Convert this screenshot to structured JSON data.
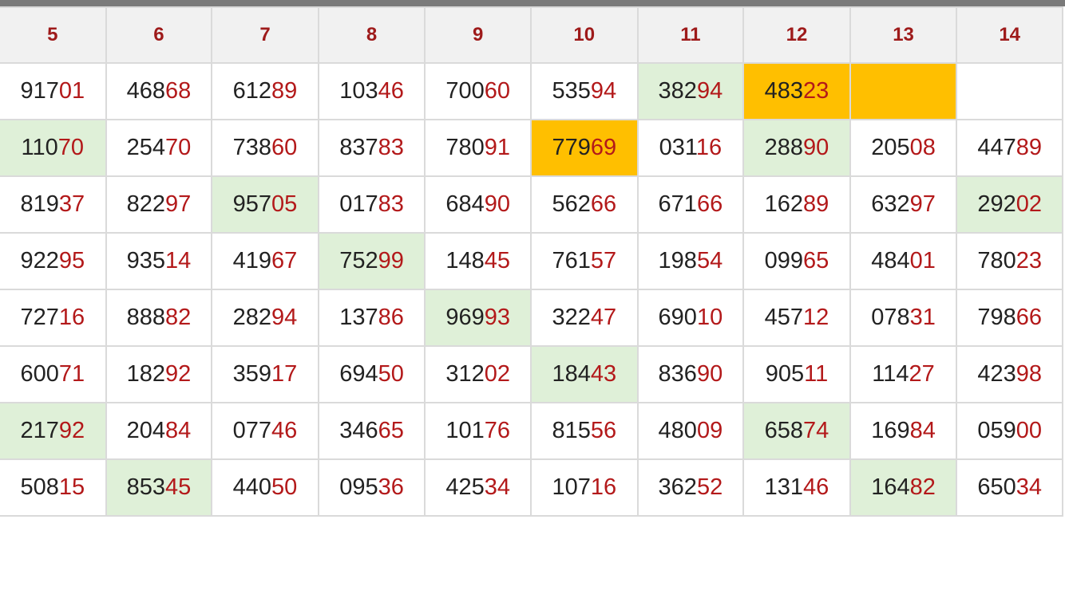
{
  "colors": {
    "header_text": "#9e1a1a",
    "tail_digits": "#b3191a",
    "green_highlight": "#dff0d8",
    "orange_highlight": "#ffbf00"
  },
  "columns": [
    "5",
    "6",
    "7",
    "8",
    "9",
    "10",
    "11",
    "12",
    "13",
    "14"
  ],
  "rows": [
    [
      {
        "head": "917",
        "tail": "01"
      },
      {
        "head": "468",
        "tail": "68"
      },
      {
        "head": "612",
        "tail": "89"
      },
      {
        "head": "103",
        "tail": "46"
      },
      {
        "head": "700",
        "tail": "60"
      },
      {
        "head": "535",
        "tail": "94"
      },
      {
        "head": "382",
        "tail": "94",
        "hl": "green"
      },
      {
        "head": "483",
        "tail": "23",
        "hl": "orange"
      },
      {
        "head": "",
        "tail": "",
        "hl": "orange"
      },
      {
        "head": "",
        "tail": ""
      }
    ],
    [
      {
        "head": "110",
        "tail": "70",
        "hl": "green"
      },
      {
        "head": "254",
        "tail": "70"
      },
      {
        "head": "738",
        "tail": "60"
      },
      {
        "head": "837",
        "tail": "83"
      },
      {
        "head": "780",
        "tail": "91"
      },
      {
        "head": "779",
        "tail": "69",
        "hl": "orange"
      },
      {
        "head": "031",
        "tail": "16"
      },
      {
        "head": "288",
        "tail": "90",
        "hl": "green"
      },
      {
        "head": "205",
        "tail": "08"
      },
      {
        "head": "447",
        "tail": "89"
      }
    ],
    [
      {
        "head": "819",
        "tail": "37"
      },
      {
        "head": "822",
        "tail": "97"
      },
      {
        "head": "957",
        "tail": "05",
        "hl": "green"
      },
      {
        "head": "017",
        "tail": "83"
      },
      {
        "head": "684",
        "tail": "90"
      },
      {
        "head": "562",
        "tail": "66"
      },
      {
        "head": "671",
        "tail": "66"
      },
      {
        "head": "162",
        "tail": "89"
      },
      {
        "head": "632",
        "tail": "97"
      },
      {
        "head": "292",
        "tail": "02",
        "hl": "green"
      }
    ],
    [
      {
        "head": "922",
        "tail": "95"
      },
      {
        "head": "935",
        "tail": "14"
      },
      {
        "head": "419",
        "tail": "67"
      },
      {
        "head": "752",
        "tail": "99",
        "hl": "green"
      },
      {
        "head": "148",
        "tail": "45"
      },
      {
        "head": "761",
        "tail": "57"
      },
      {
        "head": "198",
        "tail": "54"
      },
      {
        "head": "099",
        "tail": "65"
      },
      {
        "head": "484",
        "tail": "01"
      },
      {
        "head": "780",
        "tail": "23"
      }
    ],
    [
      {
        "head": "727",
        "tail": "16"
      },
      {
        "head": "888",
        "tail": "82"
      },
      {
        "head": "282",
        "tail": "94"
      },
      {
        "head": "137",
        "tail": "86"
      },
      {
        "head": "969",
        "tail": "93",
        "hl": "green"
      },
      {
        "head": "322",
        "tail": "47"
      },
      {
        "head": "690",
        "tail": "10"
      },
      {
        "head": "457",
        "tail": "12"
      },
      {
        "head": "078",
        "tail": "31"
      },
      {
        "head": "798",
        "tail": "66"
      }
    ],
    [
      {
        "head": "600",
        "tail": "71"
      },
      {
        "head": "182",
        "tail": "92"
      },
      {
        "head": "359",
        "tail": "17"
      },
      {
        "head": "694",
        "tail": "50"
      },
      {
        "head": "312",
        "tail": "02"
      },
      {
        "head": "184",
        "tail": "43",
        "hl": "green"
      },
      {
        "head": "836",
        "tail": "90"
      },
      {
        "head": "905",
        "tail": "11"
      },
      {
        "head": "114",
        "tail": "27"
      },
      {
        "head": "423",
        "tail": "98"
      }
    ],
    [
      {
        "head": "217",
        "tail": "92",
        "hl": "green"
      },
      {
        "head": "204",
        "tail": "84"
      },
      {
        "head": "077",
        "tail": "46"
      },
      {
        "head": "346",
        "tail": "65"
      },
      {
        "head": "101",
        "tail": "76"
      },
      {
        "head": "815",
        "tail": "56"
      },
      {
        "head": "480",
        "tail": "09"
      },
      {
        "head": "658",
        "tail": "74",
        "hl": "green"
      },
      {
        "head": "169",
        "tail": "84"
      },
      {
        "head": "059",
        "tail": "00"
      }
    ],
    [
      {
        "head": "508",
        "tail": "15"
      },
      {
        "head": "853",
        "tail": "45",
        "hl": "green"
      },
      {
        "head": "440",
        "tail": "50"
      },
      {
        "head": "095",
        "tail": "36"
      },
      {
        "head": "425",
        "tail": "34"
      },
      {
        "head": "107",
        "tail": "16"
      },
      {
        "head": "362",
        "tail": "52"
      },
      {
        "head": "131",
        "tail": "46"
      },
      {
        "head": "164",
        "tail": "82",
        "hl": "green"
      },
      {
        "head": "650",
        "tail": "34"
      }
    ]
  ]
}
